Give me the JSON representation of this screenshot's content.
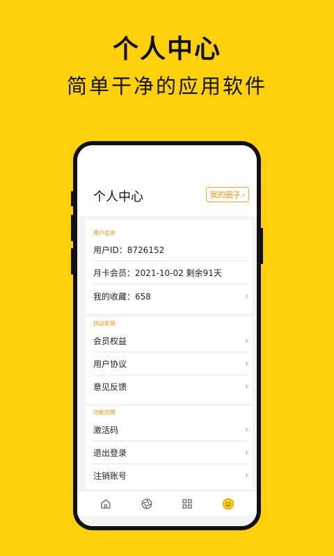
{
  "hero": {
    "title": "个人中心",
    "subtitle": "简单干净的应用软件"
  },
  "phone_screen": {
    "page_title": "个人中心",
    "circle_button_label": "我的圈子",
    "sections": [
      {
        "label": "用户信息",
        "rows": [
          {
            "text": "用户ID：8726152",
            "chevron": false
          },
          {
            "text": "月卡会员：2021-10-02 剩余91天",
            "chevron": false
          },
          {
            "text": "我的收藏：658",
            "chevron": true
          }
        ]
      },
      {
        "label": "协议反馈",
        "rows": [
          {
            "text": "会员权益",
            "chevron": true
          },
          {
            "text": "用户协议",
            "chevron": true
          },
          {
            "text": "意见反馈",
            "chevron": true
          }
        ]
      },
      {
        "label": "功能应用",
        "rows": [
          {
            "text": "激活码",
            "chevron": true
          },
          {
            "text": "退出登录",
            "chevron": true
          },
          {
            "text": "注销账号",
            "chevron": true
          }
        ]
      }
    ],
    "tabbar": [
      {
        "icon": "home-icon",
        "active": false
      },
      {
        "icon": "aperture-icon",
        "active": false
      },
      {
        "icon": "grid-icon",
        "active": false
      },
      {
        "icon": "smile-icon",
        "active": true
      }
    ]
  },
  "colors": {
    "background": "#FED10A",
    "accent": "#F5A623",
    "phone_frame": "#111111"
  }
}
